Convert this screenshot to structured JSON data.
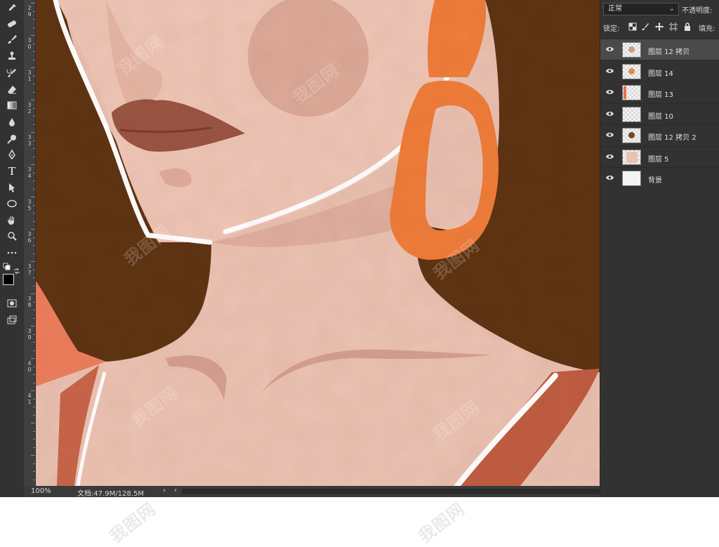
{
  "app": {
    "blend_mode": "正常",
    "opacity_label": "不透明度:",
    "lock_label": "锁定:",
    "fill_label": "填充:",
    "zoom": "100%",
    "doc_info": "文档:47.9M/128.5M",
    "status_arrow": "›",
    "status_left": "‹"
  },
  "ruler": {
    "ticks": [
      "2",
      "9",
      "3",
      "0",
      "3",
      "1",
      "3",
      "2",
      "3",
      "3",
      "3",
      "4",
      "3",
      "5",
      "3",
      "6",
      "3",
      "7",
      "3",
      "8",
      "3",
      "9",
      "4",
      "0",
      "4",
      "1"
    ]
  },
  "layers": [
    {
      "name": "图层 12 拷贝",
      "selected": true,
      "thumb": "figure"
    },
    {
      "name": "图层 14",
      "selected": false,
      "thumb": "orange-dots"
    },
    {
      "name": "图层 13",
      "selected": false,
      "thumb": "orange-stripe"
    },
    {
      "name": "图层 10",
      "selected": false,
      "thumb": "empty"
    },
    {
      "name": "图层 12 拷贝 2",
      "selected": false,
      "thumb": "brown-dot"
    },
    {
      "name": "图层 5",
      "selected": false,
      "thumb": "skin"
    },
    {
      "name": "背景",
      "selected": false,
      "thumb": "white"
    }
  ],
  "watermark": {
    "text": "我图网"
  },
  "icons": {
    "tools": [
      "eyedropper-icon",
      "healing-icon",
      "brush-icon",
      "stamp-icon",
      "history-brush-icon",
      "eraser-icon",
      "gradient-icon",
      "blur-icon",
      "dodge-icon",
      "pen-icon",
      "type-icon",
      "path-select-icon",
      "ellipse-icon",
      "hand-icon",
      "zoom-icon",
      "more-icon",
      "default-colors-icon",
      "swap-colors-icon",
      "quick-mask-icon",
      "screen-mode-icon"
    ]
  }
}
